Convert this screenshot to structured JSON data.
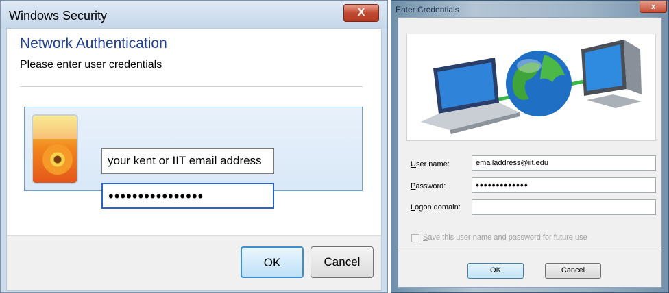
{
  "left_dialog": {
    "title": "Windows Security",
    "close_label": "X",
    "heading": "Network Authentication",
    "subheading": "Please enter user credentials",
    "username_value": "your kent or IIT email address",
    "password_value": "••••••••••••••••",
    "ok_label": "OK",
    "cancel_label": "Cancel"
  },
  "right_dialog": {
    "title": "Enter Credentials",
    "close_label": "x",
    "username_label_u": "U",
    "username_label_rest": "ser name:",
    "username_value": "emailaddress@iit.edu",
    "password_label_u": "P",
    "password_label_rest": "assword:",
    "password_value": "•••••••••••••",
    "domain_label_u": "L",
    "domain_label_rest": "ogon domain:",
    "domain_value": "",
    "save_label_u": "S",
    "save_label_rest": "ave this user name and password for future use",
    "ok_label": "OK",
    "cancel_label": "Cancel"
  },
  "colors": {
    "heading_blue": "#1e3f8e",
    "focus_blue": "#2a62c9",
    "close_red": "#c24a32"
  }
}
